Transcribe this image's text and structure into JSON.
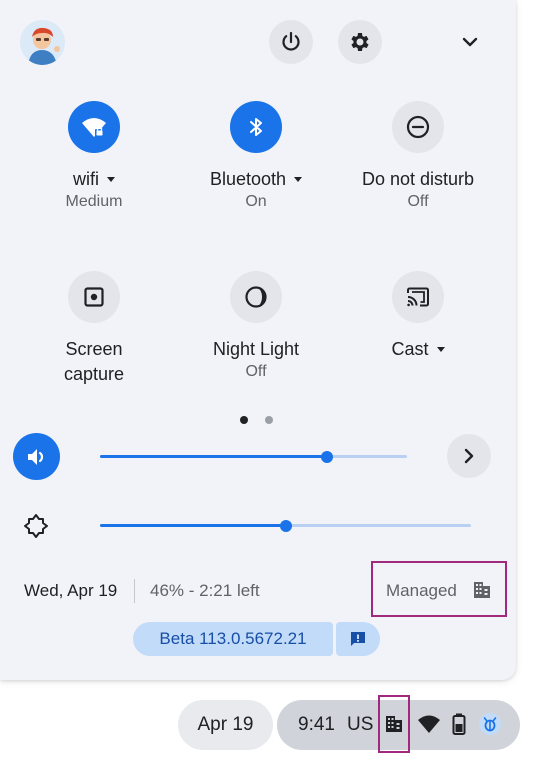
{
  "header": {
    "avatar_icon": "user-avatar-icon",
    "power_icon": "power-icon",
    "settings_icon": "gear-icon",
    "collapse_icon": "chevron-down-icon"
  },
  "tiles": [
    {
      "label": "wifi",
      "sub": "Medium",
      "active": true,
      "has_menu": true,
      "icon": "wifi-lock-icon"
    },
    {
      "label": "Bluetooth",
      "sub": "On",
      "active": true,
      "has_menu": true,
      "icon": "bluetooth-icon"
    },
    {
      "label": "Do not disturb",
      "sub": "Off",
      "active": false,
      "has_menu": false,
      "icon": "do-not-disturb-icon"
    },
    {
      "label": "Screen capture",
      "sub": "",
      "active": false,
      "has_menu": false,
      "icon": "screen-capture-icon"
    },
    {
      "label": "Night Light",
      "sub": "Off",
      "active": false,
      "has_menu": false,
      "icon": "night-light-icon"
    },
    {
      "label": "Cast",
      "sub": "",
      "active": false,
      "has_menu": true,
      "icon": "cast-icon"
    }
  ],
  "pagination": {
    "pages": 2,
    "current": 1
  },
  "volume": {
    "level": 0.74,
    "icon": "speaker-icon",
    "expand_icon": "chevron-right-icon"
  },
  "brightness": {
    "level": 0.5,
    "icon": "brightness-icon"
  },
  "footer": {
    "date": "Wed, Apr 19",
    "battery": "46% - 2:21 left",
    "managed_label": "Managed",
    "managed_icon": "building-icon"
  },
  "version": {
    "label": "Beta 113.0.5672.21",
    "feedback_icon": "feedback-icon"
  },
  "shelf": {
    "date": "Apr 19",
    "time": "9:41",
    "ime": "US",
    "icons": [
      "building-icon",
      "wifi-icon",
      "battery-icon",
      "notification-bug-icon"
    ]
  },
  "colors": {
    "accent": "#1a73e8",
    "highlight_border": "#a0287d",
    "pill_bg": "#c2dbf8",
    "panel_bg": "#f1f3f8"
  }
}
